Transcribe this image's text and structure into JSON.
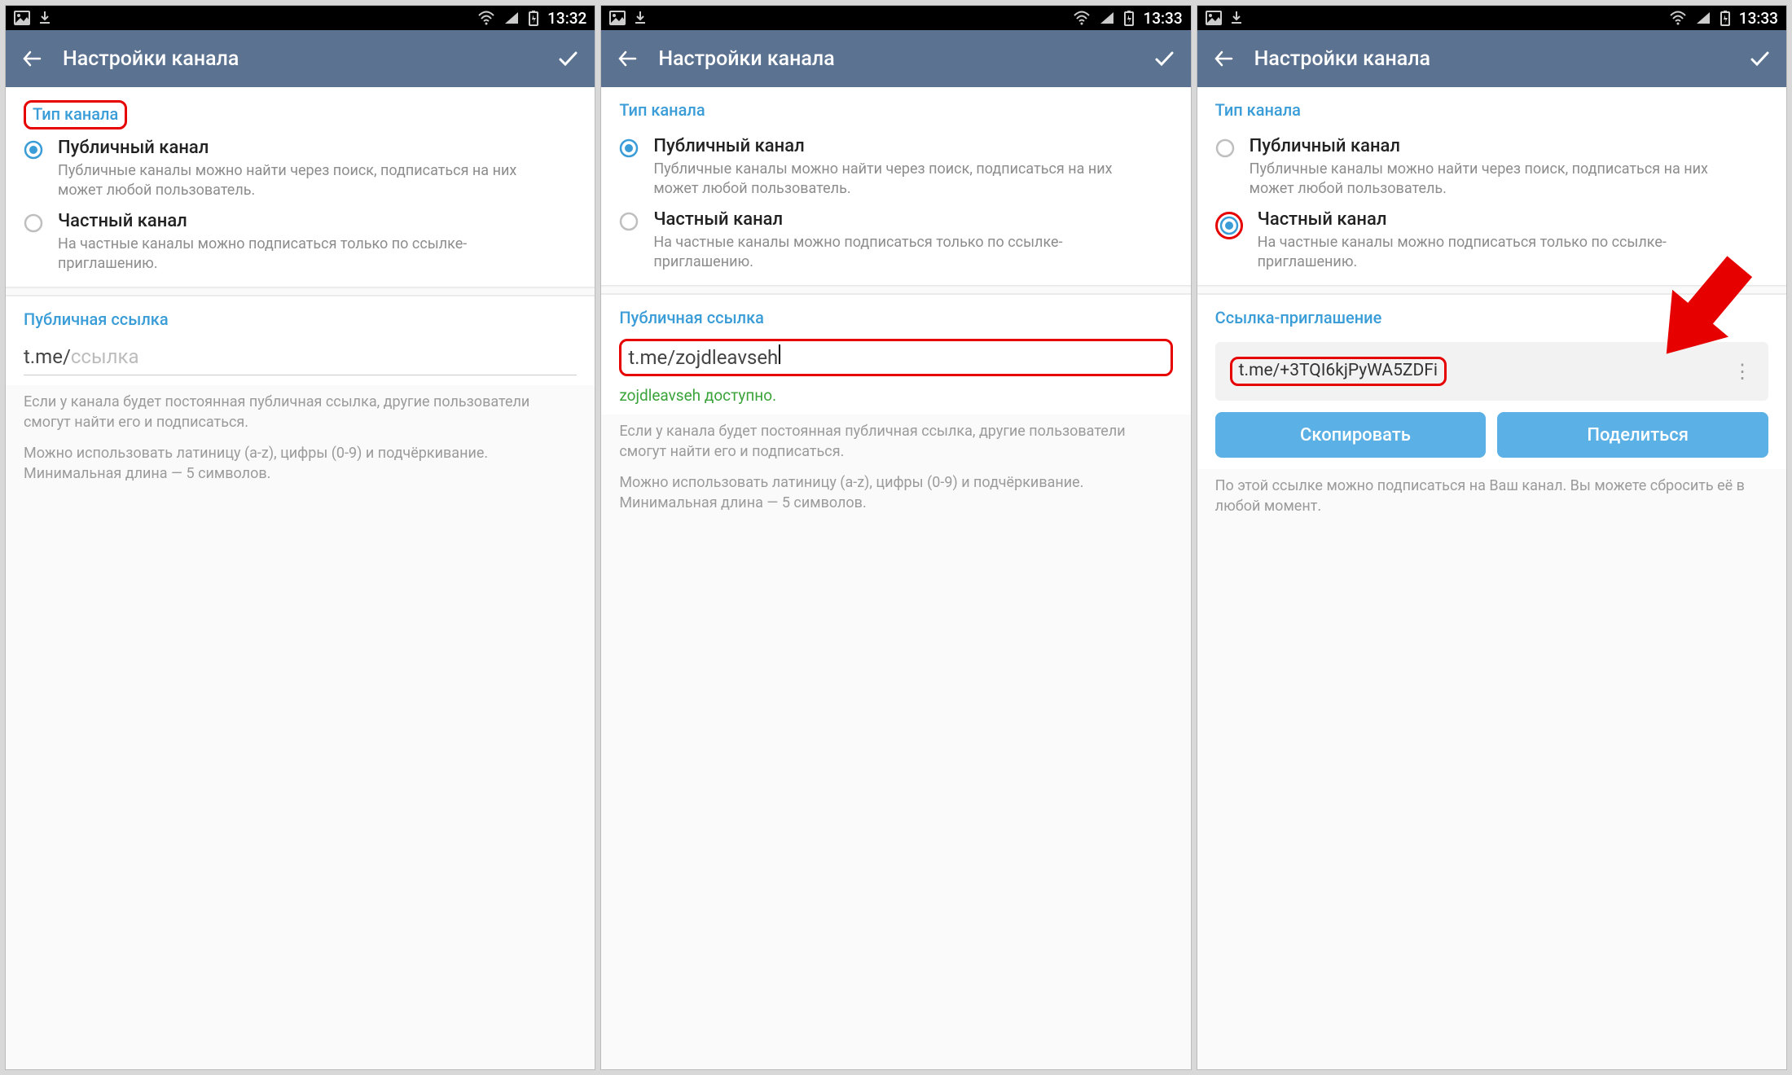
{
  "screens": [
    {
      "status": {
        "icons_left": [
          "picture",
          "download"
        ],
        "icons_right": [
          "wifi",
          "signal",
          "battery"
        ],
        "time": "13:32"
      },
      "header": {
        "title": "Настройки канала"
      },
      "type_section": {
        "header": "Тип канала",
        "header_highlighted": true,
        "public": {
          "selected": true,
          "title": "Публичный канал",
          "desc": "Публичные каналы можно найти через поиск, подписаться на них может любой пользователь."
        },
        "private": {
          "selected": false,
          "title": "Частный канал",
          "desc": "На частные каналы можно подписаться только по ссылке-приглашению.",
          "highlighted": false
        }
      },
      "link_section": {
        "header": "Публичная ссылка",
        "prefix": "t.me/",
        "value": "",
        "placeholder": "ссылка",
        "highlighted": false,
        "availability": "",
        "foot1": "Если у канала будет постоянная публичная ссылка, другие пользователи смогут найти его и подписаться.",
        "foot2": "Можно использовать латиницу (a-z), цифры (0-9) и подчёркивание. Минимальная длина — 5 символов."
      }
    },
    {
      "status": {
        "icons_left": [
          "picture",
          "download"
        ],
        "icons_right": [
          "wifi",
          "signal",
          "battery"
        ],
        "time": "13:33"
      },
      "header": {
        "title": "Настройки канала"
      },
      "type_section": {
        "header": "Тип канала",
        "header_highlighted": false,
        "public": {
          "selected": true,
          "title": "Публичный канал",
          "desc": "Публичные каналы можно найти через поиск, подписаться на них может любой пользователь."
        },
        "private": {
          "selected": false,
          "title": "Частный канал",
          "desc": "На частные каналы можно подписаться только по ссылке-приглашению.",
          "highlighted": false
        }
      },
      "link_section": {
        "header": "Публичная ссылка",
        "prefix": "t.me/",
        "value": "zojdleavseh",
        "placeholder": "",
        "highlighted": true,
        "availability": "zojdleavseh доступно.",
        "foot1": "Если у канала будет постоянная публичная ссылка, другие пользователи смогут найти его и подписаться.",
        "foot2": "Можно использовать латиницу (a-z), цифры (0-9) и подчёркивание. Минимальная длина — 5 символов."
      }
    },
    {
      "status": {
        "icons_left": [
          "picture",
          "download"
        ],
        "icons_right": [
          "wifi",
          "signal",
          "battery"
        ],
        "time": "13:33"
      },
      "header": {
        "title": "Настройки канала"
      },
      "type_section": {
        "header": "Тип канала",
        "header_highlighted": false,
        "public": {
          "selected": false,
          "title": "Публичный канал",
          "desc": "Публичные каналы можно найти через поиск, подписаться на них может любой пользователь."
        },
        "private": {
          "selected": true,
          "title": "Частный канал",
          "desc": "На частные каналы можно подписаться только по ссылке-приглашению.",
          "highlighted": true
        }
      },
      "invite_section": {
        "header": "Ссылка-приглашение",
        "link": "t.me/+3TQI6kjPyWA5ZDFi",
        "highlighted": true,
        "copy": "Скопировать",
        "share": "Поделиться",
        "foot": "По этой ссылке можно подписаться на Ваш канал. Вы можете сбросить её в любой момент."
      }
    }
  ]
}
